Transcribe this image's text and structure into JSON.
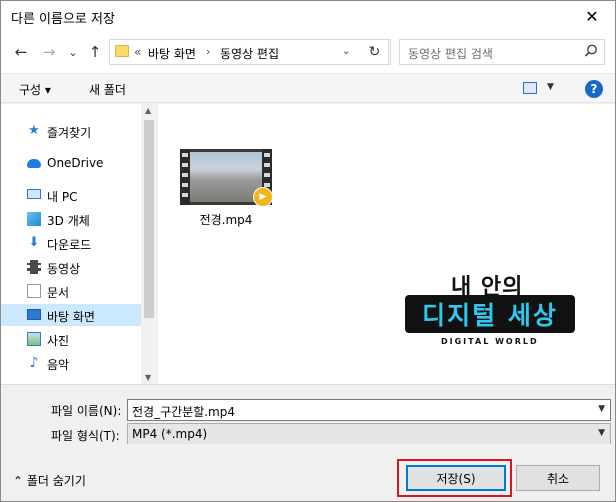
{
  "window": {
    "title": "다른 이름으로 저장",
    "close": "✕"
  },
  "nav": {
    "back": "←",
    "forward": "→",
    "recent": "⌄",
    "up": "↑"
  },
  "address": {
    "overflow": "«",
    "crumb1": "바탕 화면",
    "sep": "›",
    "crumb2": "동영상 편집",
    "chevron": "⌄",
    "refresh": "↻"
  },
  "search": {
    "placeholder": "동영상 편집 검색",
    "icon": "search-icon"
  },
  "toolbar": {
    "organize": "구성 ▾",
    "new_folder": "새 폴더",
    "help": "?"
  },
  "sidebar": {
    "items": [
      {
        "label": "즐겨찾기",
        "icon": "star-icon"
      },
      {
        "label": "OneDrive",
        "icon": "cloud-icon"
      },
      {
        "label": "내 PC",
        "icon": "pc-icon"
      },
      {
        "label": "3D 개체",
        "icon": "cube-icon"
      },
      {
        "label": "다운로드",
        "icon": "download-icon"
      },
      {
        "label": "동영상",
        "icon": "film-icon"
      },
      {
        "label": "문서",
        "icon": "document-icon"
      },
      {
        "label": "바탕 화면",
        "icon": "desktop-icon",
        "selected": true
      },
      {
        "label": "사진",
        "icon": "picture-icon"
      },
      {
        "label": "음악",
        "icon": "music-icon"
      }
    ]
  },
  "files": [
    {
      "name": "전경.mp4",
      "type": "video"
    }
  ],
  "watermark": {
    "line1": "내 안의",
    "line2": "디지털 세상",
    "line3": "DIGITAL WORLD"
  },
  "form": {
    "filename_label": "파일 이름(N):",
    "filename_value": "전경_구간분할.mp4",
    "filetype_label": "파일 형식(T):",
    "filetype_value": "MP4 (*.mp4)"
  },
  "footer": {
    "hide_folders": "⌃  폴더 숨기기",
    "save": "저장(S)",
    "cancel": "취소"
  },
  "colors": {
    "highlight": "#e0141e",
    "selected": "#cce8ff",
    "accent": "#0078d7"
  }
}
